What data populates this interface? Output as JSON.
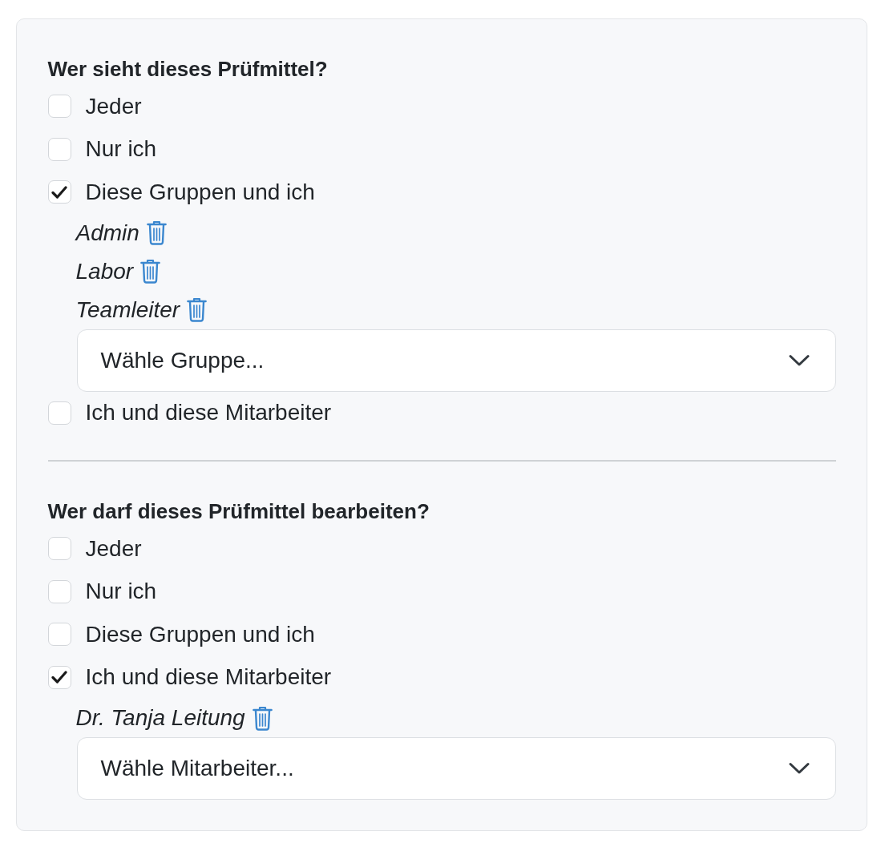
{
  "sections": [
    {
      "heading": "Wer sieht dieses Prüfmittel?",
      "options": [
        {
          "label": "Jeder",
          "checked": false
        },
        {
          "label": "Nur ich",
          "checked": false
        },
        {
          "label": "Diese Gruppen und ich",
          "checked": true,
          "entries": [
            "Admin",
            "Labor",
            "Teamleiter"
          ],
          "select": {
            "placeholder": "Wähle Gruppe..."
          }
        },
        {
          "label": "Ich und diese Mitarbeiter",
          "checked": false
        }
      ]
    },
    {
      "heading": "Wer darf dieses Prüfmittel bearbeiten?",
      "options": [
        {
          "label": "Jeder",
          "checked": false
        },
        {
          "label": "Nur ich",
          "checked": false
        },
        {
          "label": "Diese Gruppen und ich",
          "checked": false
        },
        {
          "label": "Ich und diese Mitarbeiter",
          "checked": true,
          "entries": [
            "Dr. Tanja Leitung"
          ],
          "select": {
            "placeholder": "Wähle Mitarbeiter..."
          }
        }
      ]
    }
  ]
}
